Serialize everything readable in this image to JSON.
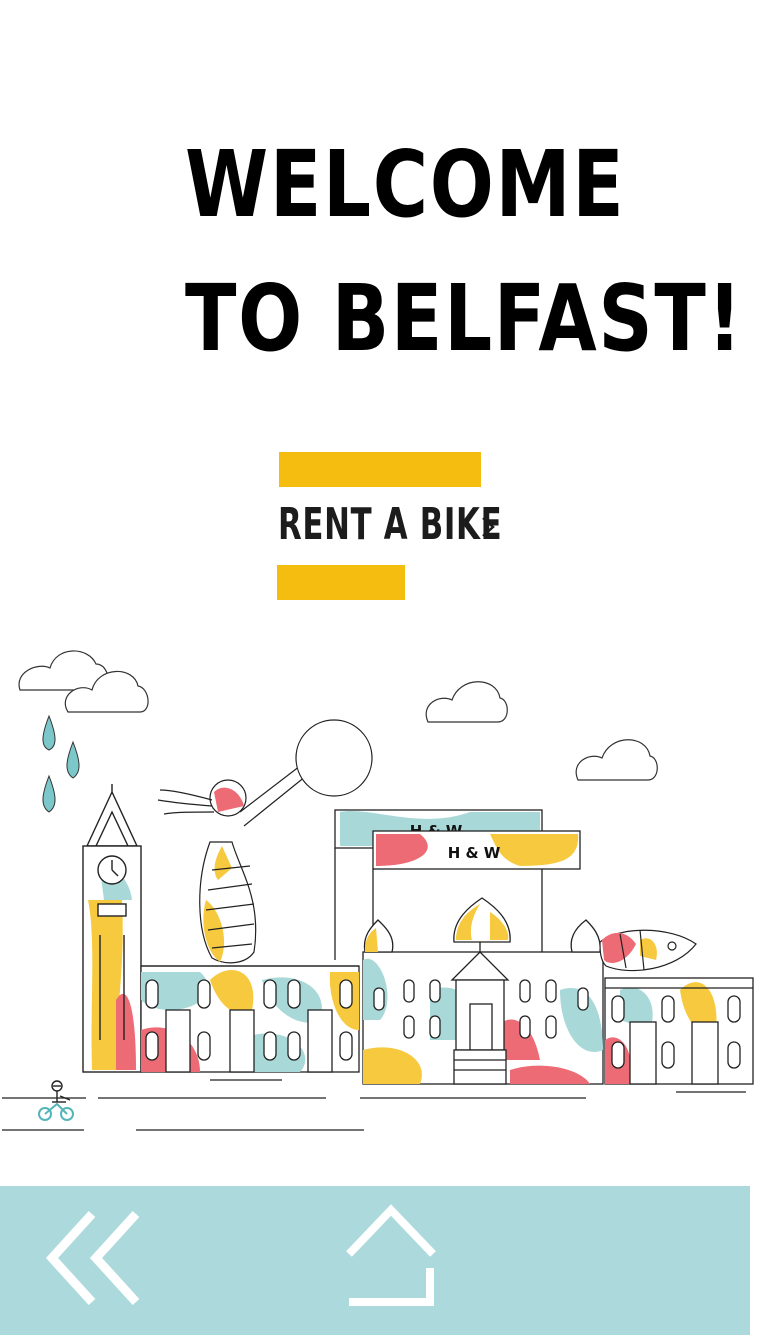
{
  "hero": {
    "title_line1": "WELCOME",
    "title_line2": "TO BELFAST!"
  },
  "cta": {
    "label": "RENT A BIKE",
    "chevron_icon": "chevron-right-icon"
  },
  "illustration": {
    "sign_text_back": "H & W",
    "sign_text_front": "H & W"
  },
  "nav": {
    "back_icon": "double-chevron-left-icon",
    "home_icon": "home-icon"
  },
  "colors": {
    "accent_yellow": "#f6bd11",
    "nav_background": "#acdadc",
    "illus_teal": "#a9d8d9",
    "illus_red": "#ec6b75",
    "illus_yellow": "#f7c93e"
  }
}
